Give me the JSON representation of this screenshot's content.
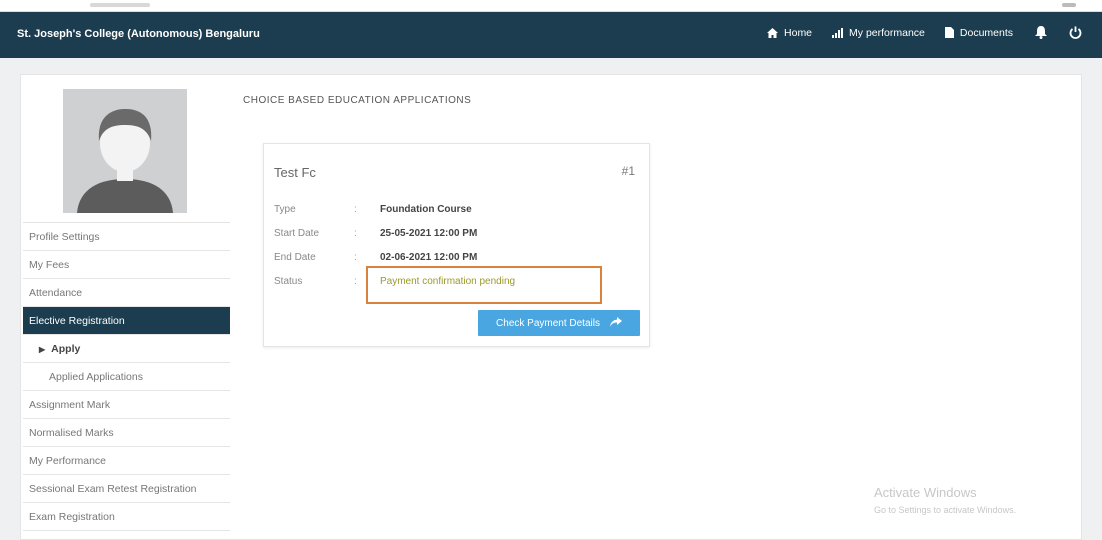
{
  "navbar": {
    "brand": "St. Joseph's College (Autonomous) Bengaluru",
    "links": [
      {
        "label": "Home",
        "icon": "home-icon"
      },
      {
        "label": "My performance",
        "icon": "bar-chart-icon"
      },
      {
        "label": "Documents",
        "icon": "document-icon"
      }
    ],
    "icons": [
      "bell-icon",
      "power-icon"
    ],
    "bg_color": "#1c3d4f"
  },
  "sidebar": {
    "items": [
      {
        "label": "Profile Settings"
      },
      {
        "label": "My Fees"
      },
      {
        "label": "Attendance"
      },
      {
        "label": "Elective Registration"
      },
      {
        "label": "Apply"
      },
      {
        "label": "Applied Applications"
      },
      {
        "label": "Assignment Mark"
      },
      {
        "label": "Normalised Marks"
      },
      {
        "label": "My Performance"
      },
      {
        "label": "Sessional Exam Retest Registration"
      },
      {
        "label": "Exam Registration"
      }
    ]
  },
  "main": {
    "title": "CHOICE BASED EDUCATION APPLICATIONS",
    "card": {
      "title": "Test Fc",
      "number": "#1",
      "rows": [
        {
          "label": "Type",
          "sep": ":",
          "value": "Foundation Course"
        },
        {
          "label": "Start Date",
          "sep": ":",
          "value": "25-05-2021 12:00 PM"
        },
        {
          "label": "End Date",
          "sep": ":",
          "value": "02-06-2021 12:00 PM"
        },
        {
          "label": "Status",
          "sep": ":",
          "value": "Payment confirmation pending"
        }
      ],
      "button_label": "Check Payment Details",
      "highlight_color": "#d9823c",
      "button_color": "#4aa6e0"
    }
  },
  "watermark": {
    "line1": "Activate Windows",
    "line2": "Go to Settings to activate Windows."
  }
}
